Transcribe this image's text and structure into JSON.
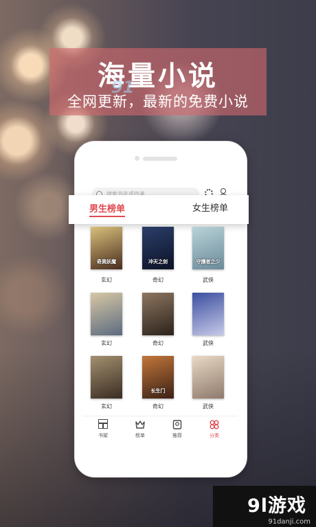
{
  "promo": {
    "headline": "海量小说",
    "subline": "全网更新，最新的免费小说",
    "logo_mark": "91"
  },
  "app": {
    "search_placeholder": "搜索书名或作者",
    "tabs": [
      {
        "label": "男生榜单",
        "active": true
      },
      {
        "label": "女生榜单",
        "active": false
      }
    ],
    "books": [
      {
        "cover_title": "奇異妖魔",
        "genre": "玄幻",
        "colors": [
          "#d9c07a",
          "#4a2e20"
        ]
      },
      {
        "cover_title": "冲天之剑",
        "genre": "奇幻",
        "colors": [
          "#2b3f6a",
          "#0d1226"
        ]
      },
      {
        "cover_title": "守護者之少",
        "genre": "武侠",
        "colors": [
          "#b9d3d8",
          "#6b8b9a"
        ]
      },
      {
        "cover_title": "",
        "genre": "玄幻",
        "colors": [
          "#d7c7a5",
          "#5c6b80"
        ]
      },
      {
        "cover_title": "",
        "genre": "奇幻",
        "colors": [
          "#8c7560",
          "#2c231c"
        ]
      },
      {
        "cover_title": "",
        "genre": "武侠",
        "colors": [
          "#3c4fa0",
          "#c7c9e8"
        ]
      },
      {
        "cover_title": "",
        "genre": "玄幻",
        "colors": [
          "#a39070",
          "#3a2c22"
        ]
      },
      {
        "cover_title": "长生门",
        "genre": "奇幻",
        "colors": [
          "#c2763a",
          "#3b2115"
        ]
      },
      {
        "cover_title": "",
        "genre": "武侠",
        "colors": [
          "#ead9c6",
          "#8e7a6c"
        ]
      }
    ],
    "nav": [
      {
        "label": "书架",
        "icon": "bookshelf-icon",
        "active": false
      },
      {
        "label": "榜单",
        "icon": "crown-icon",
        "active": false
      },
      {
        "label": "推荐",
        "icon": "recommend-icon",
        "active": false
      },
      {
        "label": "分类",
        "icon": "category-icon",
        "active": true
      }
    ]
  },
  "watermark": {
    "brand": "9l游戏",
    "url": "91danji.com"
  },
  "colors": {
    "accent": "#e0484e",
    "banner": "#d2696e"
  }
}
